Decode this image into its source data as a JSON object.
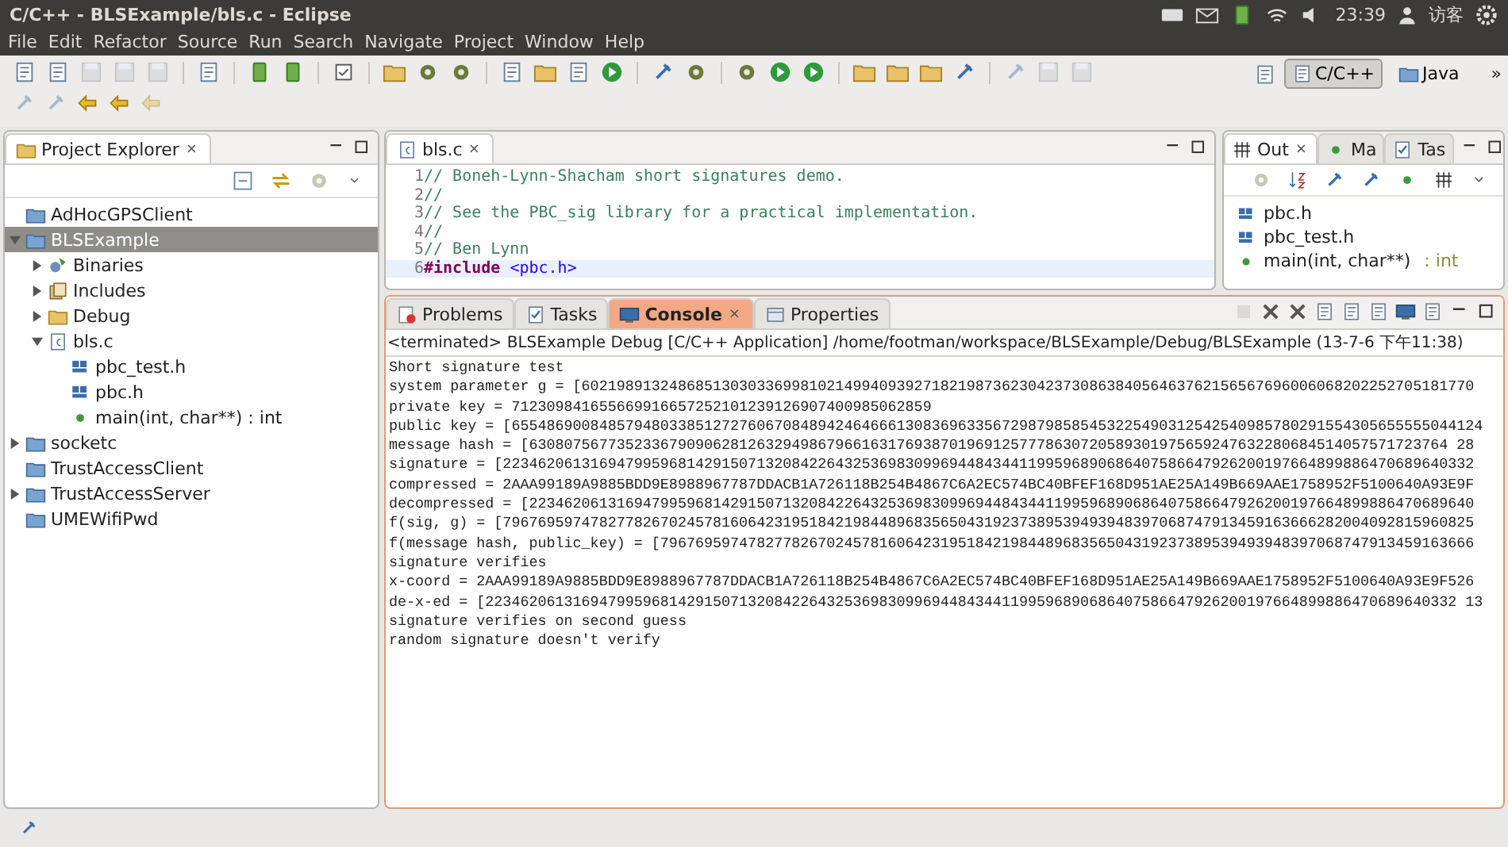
{
  "window": {
    "title": "C/C++ - BLSExample/bls.c - Eclipse"
  },
  "top_panel": {
    "clock": "23:39",
    "user": "访客"
  },
  "menu": [
    "File",
    "Edit",
    "Refactor",
    "Source",
    "Run",
    "Search",
    "Navigate",
    "Project",
    "Window",
    "Help"
  ],
  "perspectives": [
    {
      "label": "C/C++",
      "selected": true
    },
    {
      "label": "Java",
      "selected": false
    }
  ],
  "toolbar_overflow": "»",
  "project_explorer": {
    "title": "Project Explorer",
    "items": [
      {
        "label": "AdHocGPSClient",
        "kind": "project",
        "selected": false
      },
      {
        "label": "BLSExample",
        "kind": "project",
        "expanded": true,
        "selected": true,
        "children": [
          {
            "label": "Binaries",
            "kind": "binaries",
            "expanded": false,
            "selected": false
          },
          {
            "label": "Includes",
            "kind": "includes",
            "expanded": false,
            "selected": false
          },
          {
            "label": "Debug",
            "kind": "folder",
            "expanded": false,
            "selected": false
          },
          {
            "label": "bls.c",
            "kind": "source",
            "expanded": true,
            "selected": false,
            "children": [
              {
                "label": "pbc_test.h",
                "kind": "header",
                "selected": false
              },
              {
                "label": "pbc.h",
                "kind": "header",
                "selected": false
              },
              {
                "label": "main(int, char**) : int",
                "kind": "function",
                "selected": false
              }
            ]
          }
        ]
      },
      {
        "label": "socketc",
        "kind": "project",
        "expanded": false,
        "selected": false
      },
      {
        "label": "TrustAccessClient",
        "kind": "project",
        "selected": false
      },
      {
        "label": "TrustAccessServer",
        "kind": "project",
        "expanded": false,
        "selected": false
      },
      {
        "label": "UMEWifiPwd",
        "kind": "project",
        "selected": false
      }
    ]
  },
  "editor": {
    "tab": "bls.c",
    "lines": [
      {
        "number": "1",
        "kind": "comment",
        "text": "// Boneh-Lynn-Shacham short signatures demo.",
        "current": false
      },
      {
        "number": "2",
        "kind": "comment",
        "text": "//",
        "current": false
      },
      {
        "number": "3",
        "kind": "comment",
        "text": "// See the PBC_sig library for a practical implementation.",
        "current": false
      },
      {
        "number": "4",
        "kind": "comment",
        "text": "//",
        "current": false
      },
      {
        "number": "5",
        "kind": "comment",
        "text": "// Ben Lynn",
        "current": false
      },
      {
        "number": "6",
        "kind": "include",
        "keyword": "#include",
        "text": "<pbc.h>",
        "current": true
      }
    ]
  },
  "outline": {
    "tabs": [
      {
        "label": "Out",
        "selected": true
      },
      {
        "label": "Ma",
        "selected": false
      },
      {
        "label": "Tas",
        "selected": false
      }
    ],
    "items": [
      {
        "label": "pbc.h",
        "kind": "header"
      },
      {
        "label": "pbc_test.h",
        "kind": "header"
      },
      {
        "label": "main(int, char**)",
        "type": " : int",
        "kind": "function"
      }
    ]
  },
  "console": {
    "tabs": [
      {
        "label": "Problems",
        "selected": false
      },
      {
        "label": "Tasks",
        "selected": false
      },
      {
        "label": "Console",
        "selected": true
      },
      {
        "label": "Properties",
        "selected": false
      }
    ],
    "header": "<terminated> BLSExample Debug [C/C++ Application] /home/footman/workspace/BLSExample/Debug/BLSExample (13-7-6 下午11:38)",
    "lines": [
      "Short signature test",
      "system parameter g = [602198913248685130303369981021499409392718219873623042373086384056463762156567696006068202252705181770",
      "private key = 712309841655669916657252101239126907400985062859",
      "public key = [655486900848579480338512727606708489424646661308369633567298798585453225490312542540985780291554305655555044124",
      "message hash = [630807567735233679090628126329498679661631769387019691257778630720589301975659247632280684514057571723764 28",
      "signature = [223462061316947995968142915071320842264325369830996944843441199596890686407586647926200197664899886470689640332",
      "compressed = 2AAA99189A9885BDD9E8988967787DDACB1A726118B254B4867C6A2EC574BC40BFEF168D951AE25A149B669AAE1758952F5100640A93E9F",
      "decompressed = [223462061316947995968142915071320842264325369830996944843441199596890686407586647926200197664899886470689640",
      "f(sig, g) = [796769597478277826702457816064231951842198448968356504319237389539493948397068747913459163666282004092815960825",
      "f(message hash, public_key) = [796769597478277826702457816064231951842198448968356504319237389539493948397068747913459163666",
      "signature verifies",
      "x-coord = 2AAA99189A9885BDD9E8988967787DDACB1A726118B254B4867C6A2EC574BC40BFEF168D951AE25A149B669AAE1758952F5100640A93E9F526",
      "de-x-ed = [223462061316947995968142915071320842264325369830996944843441199596890686407586647926200197664899886470689640332 13",
      "signature verifies on second guess",
      "random signature doesn't verify"
    ]
  }
}
